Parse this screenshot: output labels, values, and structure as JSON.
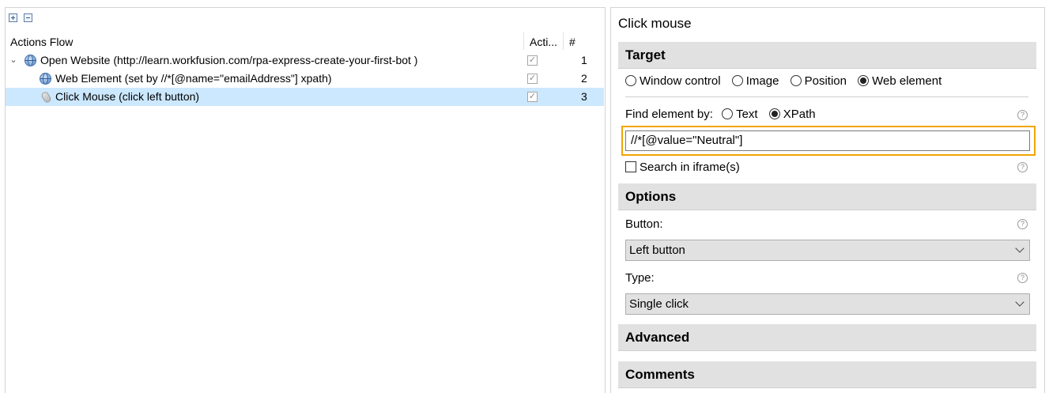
{
  "left": {
    "columns": {
      "name": "Actions Flow",
      "active": "Acti...",
      "number": "#"
    },
    "rows": [
      {
        "label": "Open Website (http://learn.workfusion.com/rpa-express-create-your-first-bot )",
        "checked": true,
        "number": "1"
      },
      {
        "label": "Web Element (set by //*[@name=\"emailAddress\"] xpath)",
        "checked": true,
        "number": "2"
      },
      {
        "label": "Click Mouse (click left button)",
        "checked": true,
        "number": "3"
      }
    ]
  },
  "right": {
    "title": "Click mouse",
    "target": {
      "heading": "Target",
      "modes": [
        "Window control",
        "Image",
        "Position",
        "Web element"
      ],
      "selected_mode": "Web element",
      "find_by_label": "Find element by:",
      "find_by_options": [
        "Text",
        "XPath"
      ],
      "find_by_selected": "XPath",
      "xpath_value": "//*[@value=\"Neutral\"]",
      "iframe_label": "Search in iframe(s)",
      "iframe_checked": false
    },
    "options": {
      "heading": "Options",
      "button_label": "Button:",
      "button_value": "Left button",
      "type_label": "Type:",
      "type_value": "Single click"
    },
    "advanced": {
      "heading": "Advanced"
    },
    "comments": {
      "heading": "Comments"
    },
    "help_glyph": "?"
  },
  "colors": {
    "selected_row": "#cce8ff",
    "focus_frame": "#f0a500",
    "section_bg": "#e1e1e1"
  }
}
